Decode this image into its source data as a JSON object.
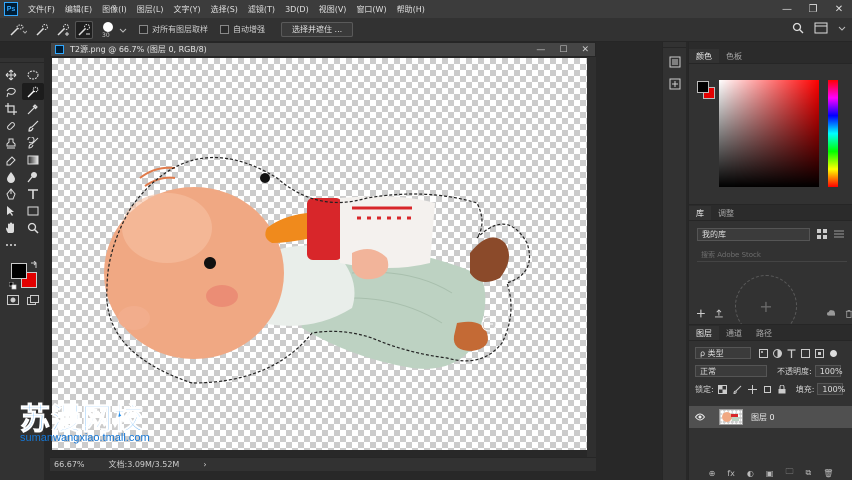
{
  "app": {
    "logo": "Ps",
    "menu": [
      "文件(F)",
      "编辑(E)",
      "图像(I)",
      "图层(L)",
      "文字(Y)",
      "选择(S)",
      "滤镜(T)",
      "3D(D)",
      "视图(V)",
      "窗口(W)",
      "帮助(H)"
    ],
    "window_controls": [
      "—",
      "❐",
      "✕"
    ]
  },
  "options": {
    "brush_size": "30",
    "sample_all_layers": "对所有图层取样",
    "auto_enhance": "自动增强",
    "select_and_mask": "选择并遮住 ..."
  },
  "document": {
    "tab_title": "T2源.png @ 66.7% (图层 0, RGB/8)",
    "controls": [
      "—",
      "☐",
      "✕"
    ],
    "zoom": "66.67%",
    "doc_info": "文档:3.09M/3.52M",
    "arrow": "›"
  },
  "watermark": {
    "title": "苏漫网校",
    "url": "sumanwangxiao.tmall.com"
  },
  "panels": {
    "color_tabs": [
      "颜色",
      "色板"
    ],
    "library_tabs": [
      "库",
      "调整"
    ],
    "library_name": "我的库",
    "library_search_placeholder": "搜索 Adobe Stock",
    "library_add": "+",
    "layers_tabs": [
      "图层",
      "通道",
      "路径"
    ],
    "layer_filter": "ρ 类型",
    "blend_mode": "正常",
    "opacity_label": "不透明度:",
    "opacity_value": "100%",
    "lock_label": "锁定:",
    "fill_label": "填充:",
    "fill_value": "100%",
    "layer_name": "图层 0",
    "footer_icons": [
      "⊕",
      "fx",
      "◐",
      "▣",
      "🗀",
      "⧉",
      "🗑"
    ]
  },
  "colors": {
    "foreground": "#000000",
    "background": "#e30000",
    "accent": "#31a8ff",
    "watermark": "#1e8ef0"
  }
}
